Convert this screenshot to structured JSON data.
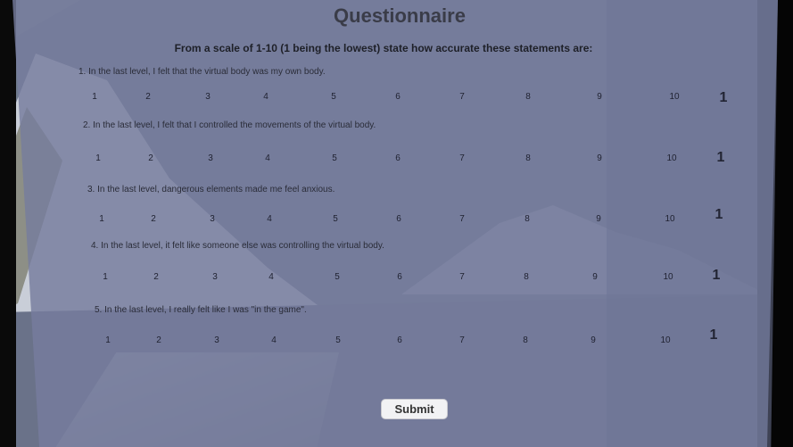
{
  "title": "Questionnaire",
  "instructions": "From a scale of 1-10 (1 being the lowest) state how accurate these statements are:",
  "questions": [
    {
      "text": "1. In the last level, I felt that the virtual body was my own body.",
      "answer": "1"
    },
    {
      "text": "2. In the last level, I felt that I controlled the movements of the virtual body.",
      "answer": "1"
    },
    {
      "text": "3. In the last level, dangerous elements made me feel anxious.",
      "answer": "1"
    },
    {
      "text": "4. In the last level, it felt like someone else was controlling the virtual body.",
      "answer": "1"
    },
    {
      "text": "5. In the last level, I really felt like I was \"in the game\".",
      "answer": "1"
    }
  ],
  "scale": [
    "1",
    "2",
    "3",
    "4",
    "5",
    "6",
    "7",
    "8",
    "9",
    "10"
  ],
  "submit_label": "Submit"
}
